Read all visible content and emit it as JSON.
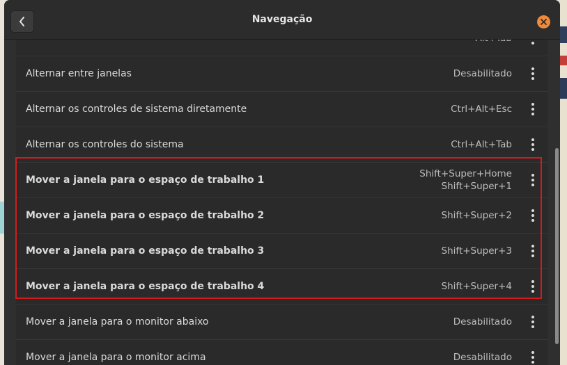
{
  "window": {
    "title": "Navegação"
  },
  "header": {
    "back_icon": "chevron-left-icon",
    "close_icon": "close-icon"
  },
  "shortcuts": [
    {
      "label": "",
      "values": [
        "Alt+Tab"
      ],
      "bold": false
    },
    {
      "label": "Alternar entre janelas",
      "values": [
        "Desabilitado"
      ],
      "bold": false
    },
    {
      "label": "Alternar os controles de sistema diretamente",
      "values": [
        "Ctrl+Alt+Esc"
      ],
      "bold": false
    },
    {
      "label": "Alternar os controles do sistema",
      "values": [
        "Ctrl+Alt+Tab"
      ],
      "bold": false
    },
    {
      "label": "Mover a janela para o espaço de trabalho 1",
      "values": [
        "Shift+Super+Home",
        "Shift+Super+1"
      ],
      "bold": true
    },
    {
      "label": "Mover a janela para o espaço de trabalho 2",
      "values": [
        "Shift+Super+2"
      ],
      "bold": true
    },
    {
      "label": "Mover a janela para o espaço de trabalho 3",
      "values": [
        "Shift+Super+3"
      ],
      "bold": true
    },
    {
      "label": "Mover a janela para o espaço de trabalho 4",
      "values": [
        "Shift+Super+4"
      ],
      "bold": true
    },
    {
      "label": "Mover a janela para o monitor abaixo",
      "values": [
        "Desabilitado"
      ],
      "bold": false
    },
    {
      "label": "Mover a janela para o monitor acima",
      "values": [
        "Desabilitado"
      ],
      "bold": false
    }
  ],
  "colors": {
    "highlight": "#d8191c",
    "close": "#ef8a3a",
    "window_bg": "#2f2f2f"
  }
}
